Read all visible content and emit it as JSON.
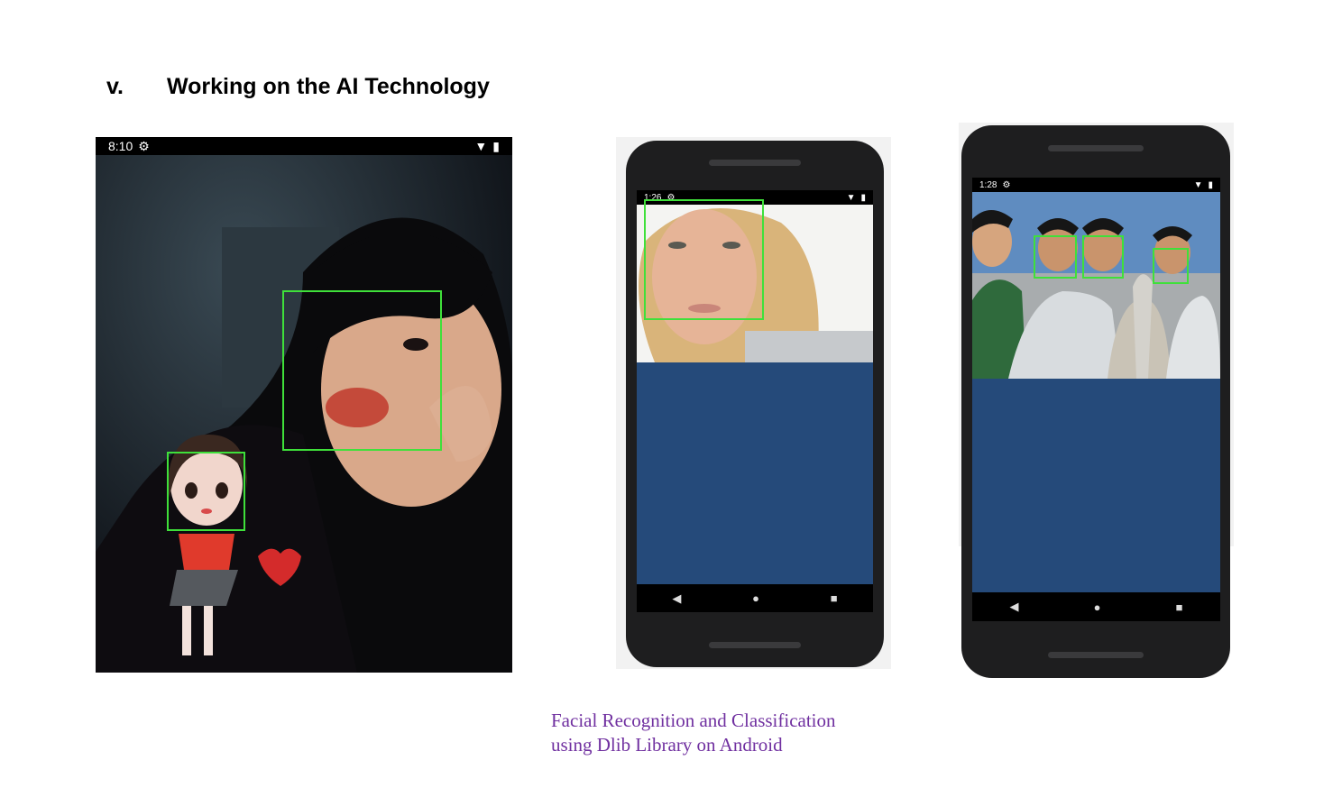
{
  "heading": {
    "number": "v.",
    "title": "Working on the AI Technology"
  },
  "figure1": {
    "time": "8:10",
    "status_icons": [
      "gear-icon",
      "wifi-icon",
      "battery-icon"
    ]
  },
  "figure2": {
    "time": "1:26",
    "navigation": [
      "back-icon",
      "home-icon",
      "recents-icon"
    ]
  },
  "figure3": {
    "time": "1:28",
    "navigation": [
      "back-icon",
      "home-icon",
      "recents-icon"
    ]
  },
  "caption": {
    "line1": "Facial Recognition and Classification",
    "line2": "using Dlib Library on Android"
  },
  "colors": {
    "caption": "#7030a0",
    "landmark_box": "#3fe03a",
    "app_background": "#254a7a"
  }
}
